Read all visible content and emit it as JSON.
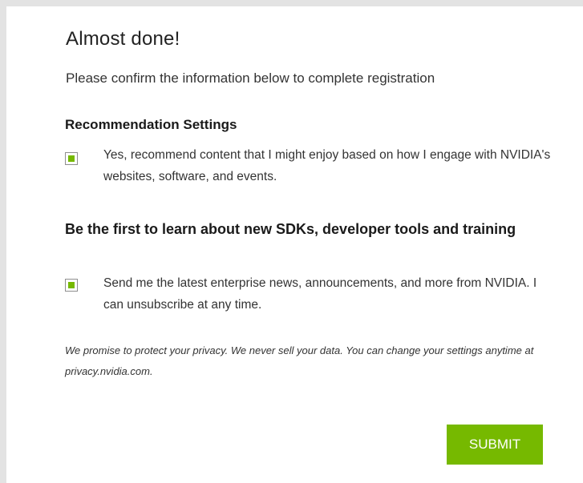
{
  "title": "Almost done!",
  "subtitle": "Please confirm the information below to complete registration",
  "recommendation": {
    "heading": "Recommendation Settings",
    "checked": true,
    "text": "Yes, recommend content that I might enjoy based on how I engage with NVIDIA's websites, software, and events."
  },
  "newsletter": {
    "heading": "Be the first to learn about new SDKs, developer tools and training",
    "checked": true,
    "text": "Send me the latest enterprise news, announcements, and more from NVIDIA. I can unsubscribe at any time."
  },
  "privacy_note": "We promise to protect your privacy. We never sell your data. You can change your settings anytime at privacy.nvidia.com.",
  "submit_label": "SUBMIT",
  "colors": {
    "accent": "#76b900",
    "frame": "#e3e3e3",
    "text": "#333333"
  }
}
